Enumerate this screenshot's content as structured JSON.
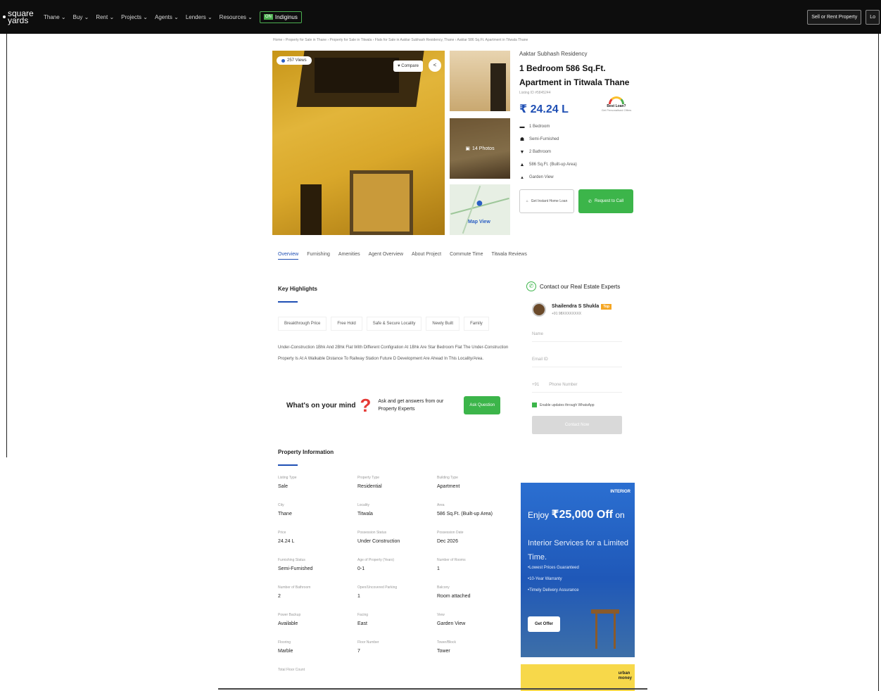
{
  "header": {
    "logo_line1": "square",
    "logo_line2": "yards",
    "nav": [
      "Thane ⌄",
      "Buy ⌄",
      "Rent ⌄",
      "Projects ⌄",
      "Agents ⌄",
      "Lenders ⌄",
      "Resources ⌄"
    ],
    "badge_tag": "ON",
    "badge_label": "Indiginus",
    "sell_btn": "Sell or Rent Property",
    "login_btn": "Lo"
  },
  "breadcrumb": "Home  ›  Property for Sale in Thane  ›  Property for Sale in Titwala  ›  Flats for Sale in Aaktar Subhash Residency, Thane  ›  Aaktar 586 Sq.Ft. Apartment in Titwala Thane",
  "gallery": {
    "views": "257 Views",
    "compare": "♥ Compare",
    "photos": "14 Photos",
    "map_label": "Map View"
  },
  "summary": {
    "project": "Aaktar Subhash Residency",
    "title": "1 Bedroom 586 Sq.Ft. Apartment in Titwala Thane",
    "listing_id": "Listing ID #5845244",
    "price": "₹ 24.24 L",
    "gauge_label": "Best Loan?",
    "gauge_sub": "Get Personalised Offers",
    "features": [
      {
        "icon": "bed-icon",
        "glyph": "▬",
        "text": "1 Bedroom"
      },
      {
        "icon": "sofa-icon",
        "glyph": "☗",
        "text": "Semi-Furnished"
      },
      {
        "icon": "bath-icon",
        "glyph": "▼",
        "text": "2 Bathroom"
      },
      {
        "icon": "area-icon",
        "glyph": "▲",
        "text": "586 Sq.Ft. (Built-up Area)"
      },
      {
        "icon": "view-icon",
        "glyph": "▴",
        "text": "Garden View"
      }
    ],
    "loan_btn": "Get Instant Home Loan",
    "call_btn": "Request to Call"
  },
  "tabs": [
    "Overview",
    "Furnishing",
    "Amenities",
    "Agent Overview",
    "About Project",
    "Commute Time",
    "Titwala Reviews"
  ],
  "highlights": {
    "title": "Key Highlights",
    "chips": [
      "Breakthrough Price",
      "Free Hold",
      "Safe & Secure Locality",
      "Newly Built",
      "Family"
    ],
    "description": "Under-Construction 1Bhk And 2Bhk Flat With Different Configration At 1Bhk Are Star Bedroom Flat The Under-Construction Property Is At A Walkable Distance To Railway Station Future D Development Are Ahead In This Locality/Area."
  },
  "ask": {
    "question": "What's on your mind",
    "text": "Ask and get answers from our Property Experts",
    "button": "Ask Question"
  },
  "property_info": {
    "title": "Property Information",
    "rows": [
      [
        {
          "k": "Listing Type",
          "v": "Sale"
        },
        {
          "k": "Property Type",
          "v": "Residential"
        },
        {
          "k": "Building Type",
          "v": "Apartment"
        }
      ],
      [
        {
          "k": "City",
          "v": "Thane"
        },
        {
          "k": "Locality",
          "v": "Titwala"
        },
        {
          "k": "Area",
          "v": "586 Sq.Ft. (Built-up Area)"
        }
      ],
      [
        {
          "k": "Price",
          "v": "24.24 L"
        },
        {
          "k": "Possession Status",
          "v": "Under Construction"
        },
        {
          "k": "Possession Date",
          "v": "Dec 2026"
        }
      ],
      [
        {
          "k": "Furnishing Status",
          "v": "Semi-Furnished"
        },
        {
          "k": "Age of Property (Years)",
          "v": "0-1"
        },
        {
          "k": "Number of Rooms",
          "v": "1"
        }
      ],
      [
        {
          "k": "Number of Bathroom",
          "v": "2"
        },
        {
          "k": "Open/Uncovered Parking",
          "v": "1"
        },
        {
          "k": "Balcony",
          "v": "Room attached"
        }
      ],
      [
        {
          "k": "Power Backup",
          "v": "Available"
        },
        {
          "k": "Facing",
          "v": "East"
        },
        {
          "k": "View",
          "v": "Garden View"
        }
      ],
      [
        {
          "k": "Flooring",
          "v": "Marble"
        },
        {
          "k": "Floor Number",
          "v": "7"
        },
        {
          "k": "Tower/Block",
          "v": "Tower"
        }
      ]
    ],
    "last_key": "Total Floor Count"
  },
  "contact": {
    "title": "Contact our Real Estate Experts",
    "agent_name": "Shailendra S Shukla",
    "agent_tag": "Top",
    "agent_phone": "+91 98XXXXXXXX",
    "name_ph": "Name",
    "email_ph": "Email ID",
    "code": "+91",
    "phone_ph": "Phone Number",
    "whatsapp": "Enable updates through   WhatsApp",
    "button": "Contact Now"
  },
  "ad": {
    "brand": "INTERIOR",
    "line1_a": "Enjoy ",
    "line1_b": "₹25,000 Off",
    "line1_c": " on",
    "line2": "Interior Services for a Limited Time.",
    "bullets": [
      "Lowest Prices Guaranteed",
      "10-Year Warranty",
      "Timely Delivery Assurance"
    ],
    "offer_btn": "Get Offer"
  },
  "ad2": {
    "brand_line1": "urban",
    "brand_line2": "money"
  }
}
